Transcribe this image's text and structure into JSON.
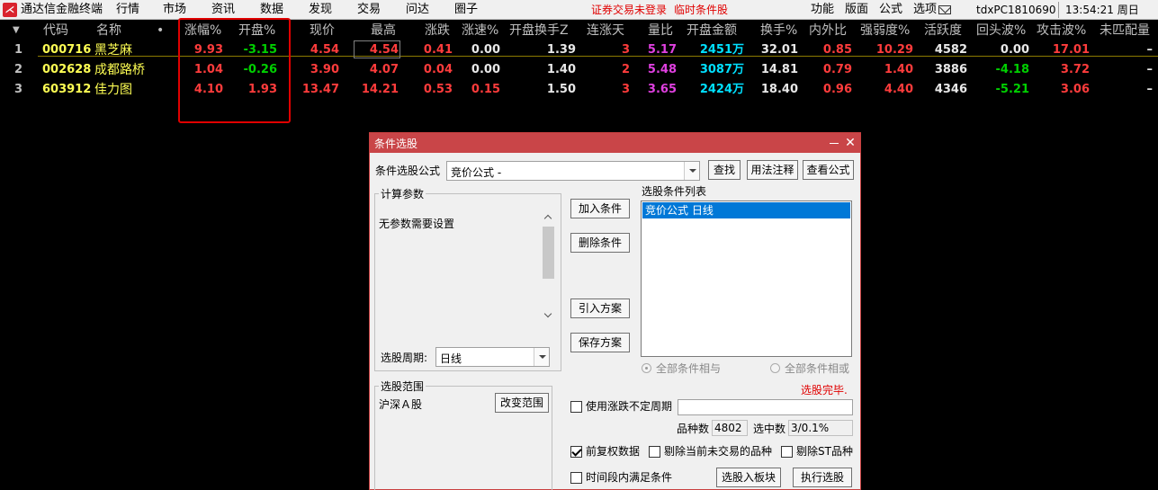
{
  "menubar": {
    "app_title": "通达信金融终端",
    "menus": [
      "行情",
      "市场",
      "资讯",
      "数据",
      "发现",
      "交易",
      "问达",
      "圈子"
    ],
    "status_login": "证券交易未登录",
    "status_mode": "临时条件股",
    "right_menus": [
      "功能",
      "版面",
      "公式",
      "选项"
    ],
    "machine_id": "tdxPC1810690",
    "clock": "13:54:21 周日"
  },
  "grid": {
    "columns": [
      "代码",
      "名称",
      "•",
      "涨幅%",
      "开盘%",
      "现价",
      "最高",
      "涨跌",
      "涨速%",
      "开盘换手Z",
      "连涨天",
      "量比",
      "开盘金额",
      "换手%",
      "内外比",
      "强弱度%",
      "活跃度",
      "回头波%",
      "攻击波%",
      "未匹配量"
    ],
    "rows": [
      {
        "idx": "1",
        "code": "000716",
        "name": "黑芝麻",
        "chg_pct": "9.93",
        "open_pct": "-3.15",
        "price": "4.54",
        "high": "4.54",
        "chg": "0.41",
        "speed": "0.00",
        "open_turnover": "1.39",
        "up_days": "3",
        "vol_ratio": "5.17",
        "open_amount": "2451万",
        "turnover": "32.01",
        "in_out": "0.85",
        "strength": "10.29",
        "activity": "4582",
        "pullback": "0.00",
        "attack": "17.01",
        "unmatched": "–"
      },
      {
        "idx": "2",
        "code": "002628",
        "name": "成都路桥",
        "chg_pct": "1.04",
        "open_pct": "-0.26",
        "price": "3.90",
        "high": "4.07",
        "chg": "0.04",
        "speed": "0.00",
        "open_turnover": "1.40",
        "up_days": "2",
        "vol_ratio": "5.48",
        "open_amount": "3087万",
        "turnover": "14.81",
        "in_out": "0.79",
        "strength": "1.40",
        "activity": "3886",
        "pullback": "-4.18",
        "attack": "3.72",
        "unmatched": "–"
      },
      {
        "idx": "3",
        "code": "603912",
        "name": "佳力图",
        "chg_pct": "4.10",
        "open_pct": "1.93",
        "price": "13.47",
        "high": "14.21",
        "chg": "0.53",
        "speed": "0.15",
        "open_turnover": "1.50",
        "up_days": "3",
        "vol_ratio": "3.65",
        "open_amount": "2424万",
        "turnover": "18.40",
        "in_out": "0.96",
        "strength": "4.40",
        "activity": "4346",
        "pullback": "-5.21",
        "attack": "3.06",
        "unmatched": "–"
      }
    ]
  },
  "dialog": {
    "title": "条件选股",
    "formula_label": "条件选股公式",
    "formula_value": "竞价公式      -",
    "btn_find": "查找",
    "btn_usage": "用法注释",
    "btn_view": "查看公式",
    "params_group": "计算参数",
    "params_text": "无参数需要设置",
    "btn_add": "加入条件",
    "btn_delete": "删除条件",
    "btn_import": "引入方案",
    "btn_save": "保存方案",
    "cond_list_label": "选股条件列表",
    "cond_items": [
      "竞价公式  日线"
    ],
    "period_label": "选股周期:",
    "period_value": "日线",
    "radio_and": "全部条件相与",
    "radio_or": "全部条件相或",
    "status": "选股完毕.",
    "scope_group": "选股范围",
    "scope_value": "沪深Ａ股",
    "btn_change_scope": "改变范围",
    "chk_unfixed_period": "使用涨跌不定周期",
    "count_label": "品种数",
    "count_value": "4802",
    "selected_label": "选中数",
    "selected_value": "3/0.1%",
    "chk_pre_adjust": "前复权数据",
    "chk_exclude_untraded": "剔除当前未交易的品种",
    "chk_exclude_st": "剔除ST品种",
    "chk_time_range": "时间段内满足条件",
    "btn_to_block": "选股入板块",
    "btn_execute": "执行选股"
  }
}
